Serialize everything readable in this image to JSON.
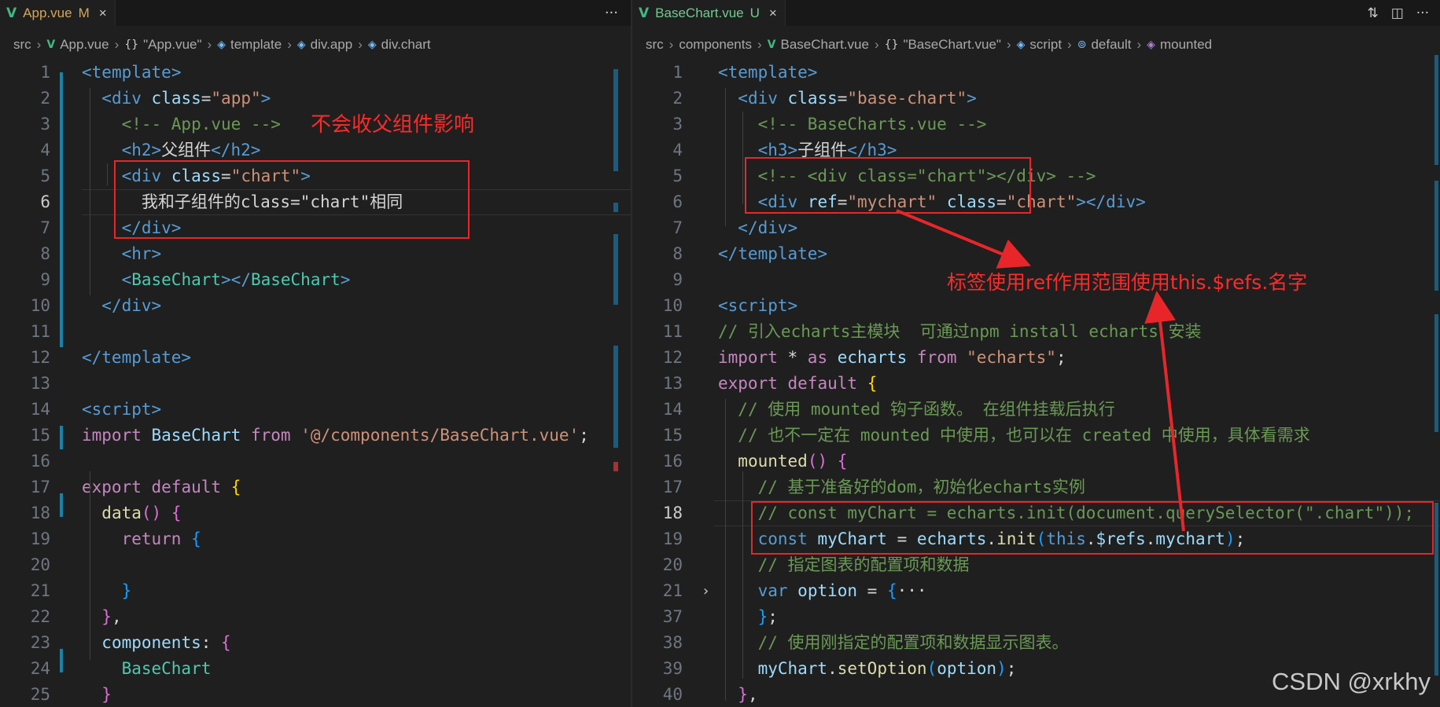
{
  "left": {
    "tab": {
      "name": "App.vue",
      "status": "M",
      "close": "×"
    },
    "more": "···",
    "breadcrumb": [
      "src",
      "App.vue",
      "\"App.vue\"",
      "template",
      "div.app",
      "div.chart"
    ],
    "lines": [
      {
        "n": "1",
        "t": [
          [
            "tag",
            "<"
          ],
          [
            "tag",
            "template"
          ],
          [
            "tag",
            ">"
          ]
        ]
      },
      {
        "n": "2",
        "t": [
          [
            "plain",
            "  "
          ],
          [
            "tag",
            "<div"
          ],
          [
            "plain",
            " "
          ],
          [
            "attr",
            "class"
          ],
          [
            "plain",
            "="
          ],
          [
            "str",
            "\"app\""
          ],
          [
            "tag",
            ">"
          ]
        ]
      },
      {
        "n": "3",
        "t": [
          [
            "plain",
            "    "
          ],
          [
            "cmt",
            "<!-- App.vue -->"
          ]
        ]
      },
      {
        "n": "4",
        "t": [
          [
            "plain",
            "    "
          ],
          [
            "tag",
            "<h2>"
          ],
          [
            "plain",
            "父组件"
          ],
          [
            "tag",
            "</h2>"
          ]
        ]
      },
      {
        "n": "5",
        "t": [
          [
            "plain",
            "    "
          ],
          [
            "tag",
            "<div"
          ],
          [
            "plain",
            " "
          ],
          [
            "attr",
            "class"
          ],
          [
            "plain",
            "="
          ],
          [
            "str",
            "\"chart\""
          ],
          [
            "tag",
            ">"
          ]
        ]
      },
      {
        "n": "6",
        "t": [
          [
            "plain",
            "      我和子组件的class=\"chart\"相同"
          ]
        ],
        "cur": true
      },
      {
        "n": "7",
        "t": [
          [
            "plain",
            "    "
          ],
          [
            "tag",
            "</div>"
          ]
        ]
      },
      {
        "n": "8",
        "t": [
          [
            "plain",
            "    "
          ],
          [
            "tag",
            "<hr>"
          ]
        ]
      },
      {
        "n": "9",
        "t": [
          [
            "plain",
            "    "
          ],
          [
            "tag",
            "<"
          ],
          [
            "comp",
            "BaseChart"
          ],
          [
            "tag",
            "></"
          ],
          [
            "comp",
            "BaseChart"
          ],
          [
            "tag",
            ">"
          ]
        ]
      },
      {
        "n": "10",
        "t": [
          [
            "plain",
            "  "
          ],
          [
            "tag",
            "</div>"
          ]
        ]
      },
      {
        "n": "11",
        "t": []
      },
      {
        "n": "12",
        "t": [
          [
            "tag",
            "</template>"
          ]
        ]
      },
      {
        "n": "13",
        "t": []
      },
      {
        "n": "14",
        "t": [
          [
            "tag",
            "<script>"
          ]
        ]
      },
      {
        "n": "15",
        "t": [
          [
            "kw",
            "import"
          ],
          [
            "plain",
            " "
          ],
          [
            "var",
            "BaseChart"
          ],
          [
            "plain",
            " "
          ],
          [
            "kw",
            "from"
          ],
          [
            "plain",
            " "
          ],
          [
            "str",
            "'@/components/BaseChart.vue'"
          ],
          [
            "plain",
            ";"
          ]
        ]
      },
      {
        "n": "16",
        "t": []
      },
      {
        "n": "17",
        "t": [
          [
            "kw",
            "export"
          ],
          [
            "plain",
            " "
          ],
          [
            "kw",
            "default"
          ],
          [
            "plain",
            " "
          ],
          [
            "br1",
            "{"
          ]
        ]
      },
      {
        "n": "18",
        "t": [
          [
            "plain",
            "  "
          ],
          [
            "fn",
            "data"
          ],
          [
            "br2",
            "()"
          ],
          [
            "plain",
            " "
          ],
          [
            "br2",
            "{"
          ]
        ]
      },
      {
        "n": "19",
        "t": [
          [
            "plain",
            "    "
          ],
          [
            "kw",
            "return"
          ],
          [
            "plain",
            " "
          ],
          [
            "br3",
            "{"
          ]
        ]
      },
      {
        "n": "20",
        "t": []
      },
      {
        "n": "21",
        "t": [
          [
            "plain",
            "    "
          ],
          [
            "br3",
            "}"
          ]
        ]
      },
      {
        "n": "22",
        "t": [
          [
            "plain",
            "  "
          ],
          [
            "br2",
            "}"
          ],
          [
            "plain",
            ","
          ]
        ]
      },
      {
        "n": "23",
        "t": [
          [
            "plain",
            "  "
          ],
          [
            "var",
            "components"
          ],
          [
            "plain",
            ": "
          ],
          [
            "br2",
            "{"
          ]
        ]
      },
      {
        "n": "24",
        "t": [
          [
            "plain",
            "    "
          ],
          [
            "comp",
            "BaseChart"
          ]
        ]
      },
      {
        "n": "25",
        "t": [
          [
            "plain",
            "  "
          ],
          [
            "br2",
            "}"
          ]
        ]
      }
    ],
    "annotation": "不会收父组件影响"
  },
  "right": {
    "tab": {
      "name": "BaseChart.vue",
      "status": "U",
      "close": "×"
    },
    "breadcrumb": [
      "src",
      "components",
      "BaseChart.vue",
      "\"BaseChart.vue\"",
      "script",
      "default",
      "mounted"
    ],
    "lines": [
      {
        "n": "1",
        "t": [
          [
            "tag",
            "<template>"
          ]
        ]
      },
      {
        "n": "2",
        "t": [
          [
            "plain",
            "  "
          ],
          [
            "tag",
            "<div"
          ],
          [
            "plain",
            " "
          ],
          [
            "attr",
            "class"
          ],
          [
            "plain",
            "="
          ],
          [
            "str",
            "\"base-chart\""
          ],
          [
            "tag",
            ">"
          ]
        ]
      },
      {
        "n": "3",
        "t": [
          [
            "plain",
            "    "
          ],
          [
            "cmt",
            "<!-- BaseCharts.vue -->"
          ]
        ]
      },
      {
        "n": "4",
        "t": [
          [
            "plain",
            "    "
          ],
          [
            "tag",
            "<h3>"
          ],
          [
            "plain",
            "子组件"
          ],
          [
            "tag",
            "</h3>"
          ]
        ]
      },
      {
        "n": "5",
        "t": [
          [
            "plain",
            "    "
          ],
          [
            "cmt",
            "<!-- <div class=\"chart\"></div> -->"
          ]
        ]
      },
      {
        "n": "6",
        "t": [
          [
            "plain",
            "    "
          ],
          [
            "tag",
            "<div"
          ],
          [
            "plain",
            " "
          ],
          [
            "attr",
            "ref"
          ],
          [
            "plain",
            "="
          ],
          [
            "str",
            "\"mychart\""
          ],
          [
            "plain",
            " "
          ],
          [
            "attr",
            "class"
          ],
          [
            "plain",
            "="
          ],
          [
            "str",
            "\"chart\""
          ],
          [
            "tag",
            "></div>"
          ]
        ]
      },
      {
        "n": "7",
        "t": [
          [
            "plain",
            "  "
          ],
          [
            "tag",
            "</div>"
          ]
        ]
      },
      {
        "n": "8",
        "t": [
          [
            "tag",
            "</template>"
          ]
        ]
      },
      {
        "n": "9",
        "t": []
      },
      {
        "n": "10",
        "t": [
          [
            "tag",
            "<script>"
          ]
        ]
      },
      {
        "n": "11",
        "t": [
          [
            "cmt",
            "// 引入echarts主模块  可通过npm install echarts 安装"
          ]
        ]
      },
      {
        "n": "12",
        "t": [
          [
            "kw",
            "import"
          ],
          [
            "plain",
            " * "
          ],
          [
            "kw",
            "as"
          ],
          [
            "plain",
            " "
          ],
          [
            "var",
            "echarts"
          ],
          [
            "plain",
            " "
          ],
          [
            "kw",
            "from"
          ],
          [
            "plain",
            " "
          ],
          [
            "str",
            "\"echarts\""
          ],
          [
            "plain",
            ";"
          ]
        ]
      },
      {
        "n": "13",
        "t": [
          [
            "kw",
            "export"
          ],
          [
            "plain",
            " "
          ],
          [
            "kw",
            "default"
          ],
          [
            "plain",
            " "
          ],
          [
            "br1",
            "{"
          ]
        ]
      },
      {
        "n": "14",
        "t": [
          [
            "plain",
            "  "
          ],
          [
            "cmt",
            "// 使用 mounted 钩子函数。 在组件挂载后执行"
          ]
        ]
      },
      {
        "n": "15",
        "t": [
          [
            "plain",
            "  "
          ],
          [
            "cmt",
            "// 也不一定在 mounted 中使用，也可以在 created 中使用，具体看需求"
          ]
        ]
      },
      {
        "n": "16",
        "t": [
          [
            "plain",
            "  "
          ],
          [
            "fn",
            "mounted"
          ],
          [
            "br2",
            "()"
          ],
          [
            "plain",
            " "
          ],
          [
            "br2",
            "{"
          ]
        ]
      },
      {
        "n": "17",
        "t": [
          [
            "plain",
            "    "
          ],
          [
            "cmt",
            "// 基于准备好的dom，初始化echarts实例"
          ]
        ]
      },
      {
        "n": "18",
        "t": [
          [
            "plain",
            "    "
          ],
          [
            "cmt",
            "// const myChart = echarts.init(document.querySelector(\".chart\"));"
          ]
        ],
        "cur": true
      },
      {
        "n": "19",
        "t": [
          [
            "plain",
            "    "
          ],
          [
            "kw2",
            "const"
          ],
          [
            "plain",
            " "
          ],
          [
            "var",
            "myChart"
          ],
          [
            "plain",
            " = "
          ],
          [
            "var",
            "echarts"
          ],
          [
            "plain",
            "."
          ],
          [
            "fn",
            "init"
          ],
          [
            "br3",
            "("
          ],
          [
            "kw2",
            "this"
          ],
          [
            "plain",
            "."
          ],
          [
            "var",
            "$refs"
          ],
          [
            "plain",
            "."
          ],
          [
            "var",
            "mychart"
          ],
          [
            "br3",
            ")"
          ],
          [
            "plain",
            ";"
          ]
        ]
      },
      {
        "n": "20",
        "t": [
          [
            "plain",
            "    "
          ],
          [
            "cmt",
            "// 指定图表的配置项和数据"
          ]
        ]
      },
      {
        "n": "21",
        "t": [
          [
            "plain",
            "    "
          ],
          [
            "kw2",
            "var"
          ],
          [
            "plain",
            " "
          ],
          [
            "var",
            "option"
          ],
          [
            "plain",
            " = "
          ],
          [
            "br3",
            "{"
          ],
          [
            "plain",
            "···"
          ]
        ],
        "fold": true
      },
      {
        "n": "37",
        "t": [
          [
            "plain",
            "    "
          ],
          [
            "br3",
            "}"
          ],
          [
            "plain",
            ";"
          ]
        ]
      },
      {
        "n": "38",
        "t": [
          [
            "plain",
            "    "
          ],
          [
            "cmt",
            "// 使用刚指定的配置项和数据显示图表。"
          ]
        ]
      },
      {
        "n": "39",
        "t": [
          [
            "plain",
            "    "
          ],
          [
            "var",
            "myChart"
          ],
          [
            "plain",
            "."
          ],
          [
            "fn",
            "setOption"
          ],
          [
            "br3",
            "("
          ],
          [
            "var",
            "option"
          ],
          [
            "br3",
            ")"
          ],
          [
            "plain",
            ";"
          ]
        ]
      },
      {
        "n": "40",
        "t": [
          [
            "plain",
            "  "
          ],
          [
            "br2",
            "}"
          ],
          [
            "plain",
            ","
          ]
        ]
      }
    ],
    "annotation": "标签使用ref作用范围使用this.$refs.名字"
  },
  "watermark": "CSDN @xrkhy"
}
